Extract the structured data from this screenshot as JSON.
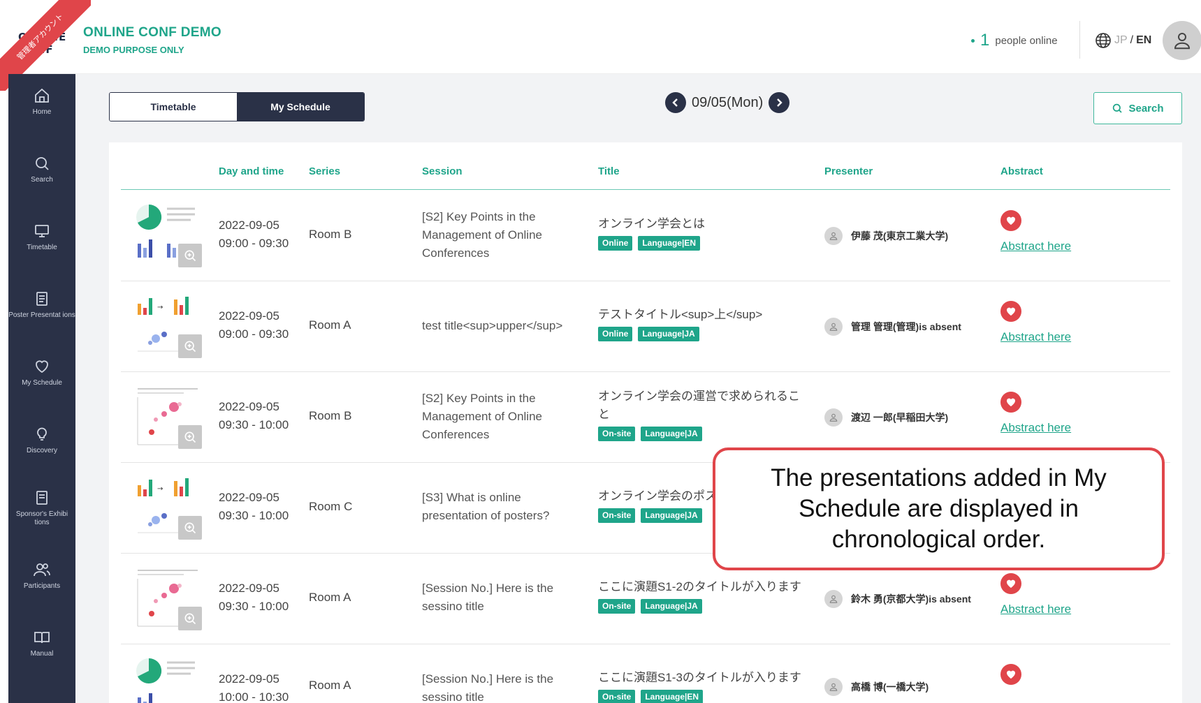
{
  "header": {
    "logo_text": "ONLINE CONF",
    "admin_ribbon": "管理者アカウント",
    "title": "ONLINE CONF DEMO",
    "subtitle": "DEMO PURPOSE ONLY",
    "online_count": "1",
    "online_label": "people online",
    "lang_jp": "JP",
    "lang_sep": "/",
    "lang_en": "EN"
  },
  "sidebar": {
    "items": [
      {
        "label": "Home",
        "icon": "home-icon"
      },
      {
        "label": "Search",
        "icon": "search-icon"
      },
      {
        "label": "Timetable",
        "icon": "monitor-icon"
      },
      {
        "label": "Poster Presentat ions",
        "icon": "poster-icon"
      },
      {
        "label": "My Schedule",
        "icon": "heart-icon"
      },
      {
        "label": "Discovery",
        "icon": "lightbulb-icon"
      },
      {
        "label": "Sponsor's Exhibi tions",
        "icon": "sponsor-icon"
      },
      {
        "label": "Participants",
        "icon": "users-icon"
      },
      {
        "label": "Manual",
        "icon": "book-icon"
      }
    ]
  },
  "toolbar": {
    "tab_timetable": "Timetable",
    "tab_myschedule": "My Schedule",
    "date": "09/05(Mon)",
    "search_label": "Search"
  },
  "table": {
    "headers": {
      "day_time": "Day and time",
      "series": "Series",
      "session": "Session",
      "title": "Title",
      "presenter": "Presenter",
      "abstract": "Abstract"
    },
    "rows": [
      {
        "date": "2022-09-05",
        "time": "09:00 - 09:30",
        "series": "Room B",
        "session": "[S2] Key Points in the Management of Online Conferences",
        "title": "オンライン学会とは",
        "badge1": "Online",
        "badge2": "Language|EN",
        "presenter": "伊藤 茂(東京工業大学)",
        "abstract": "Abstract here",
        "thumb": "pie-bar"
      },
      {
        "date": "2022-09-05",
        "time": "09:00 - 09:30",
        "series": "Room A",
        "session": "test title<sup>upper</sup>",
        "title": "テストタイトル<sup>上</sup>",
        "badge1": "Online",
        "badge2": "Language|JA",
        "presenter": "管理 管理(管理)is absent",
        "abstract": "Abstract here",
        "thumb": "bars-scatter"
      },
      {
        "date": "2022-09-05",
        "time": "09:30 - 10:00",
        "series": "Room B",
        "session": "[S2] Key Points in the Management of Online Conferences",
        "title": "オンライン学会の運営で求められること",
        "badge1": "On-site",
        "badge2": "Language|JA",
        "presenter": "渡辺 一郎(早稲田大学)",
        "abstract": "Abstract here",
        "thumb": "scatter"
      },
      {
        "date": "2022-09-05",
        "time": "09:30 - 10:00",
        "series": "Room C",
        "session": "[S3] What is online presentation of posters?",
        "title": "オンライン学会のポス",
        "badge1": "On-site",
        "badge2": "Language|JA",
        "presenter": "",
        "abstract": "",
        "thumb": "bars-scatter"
      },
      {
        "date": "2022-09-05",
        "time": "09:30 - 10:00",
        "series": "Room A",
        "session": "[Session No.] Here is the sessino title",
        "title": "ここに演題S1-2のタイトルが入ります",
        "badge1": "On-site",
        "badge2": "Language|JA",
        "presenter": "鈴木 勇(京都大学)is absent",
        "abstract": "Abstract here",
        "thumb": "scatter"
      },
      {
        "date": "2022-09-05",
        "time": "10:00 - 10:30",
        "series": "Room A",
        "session": "[Session No.] Here is the sessino title",
        "title": "ここに演題S1-3のタイトルが入ります",
        "badge1": "On-site",
        "badge2": "Language|EN",
        "presenter": "高橋 博(一橋大学)",
        "abstract": "",
        "thumb": "pie-bar"
      }
    ]
  },
  "callout": {
    "text": "The presentations added in My Schedule are displayed in chronological order."
  },
  "colors": {
    "accent": "#1fa58a",
    "sidebar": "#2a3147",
    "heart": "#e0454a"
  }
}
